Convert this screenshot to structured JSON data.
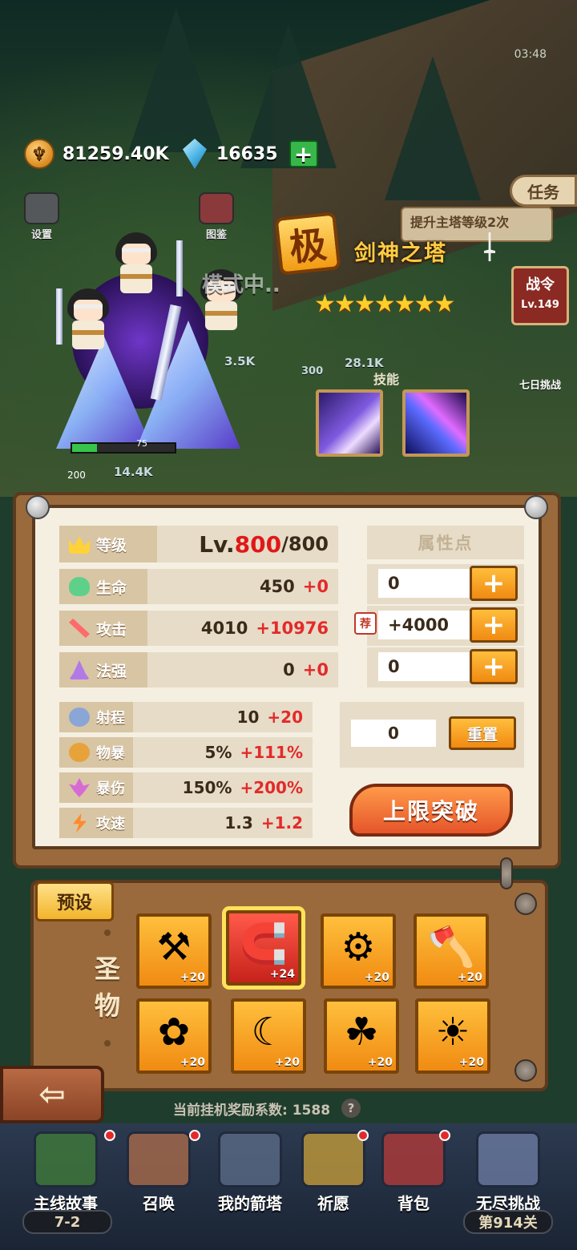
{
  "top": {
    "gold_amount": "81259.40K",
    "diamond_amount": "16635",
    "timer": "03:48"
  },
  "side_buttons": {
    "settings": "设置",
    "guide": "图鉴"
  },
  "tasks": {
    "tab_label": "任务",
    "quest_text": "提升主塔等级2次"
  },
  "battle_pass": {
    "label": "战令",
    "level": "Lv.149"
  },
  "seven_day": {
    "label": "七日挑战"
  },
  "battle": {
    "mode_text": "模式中..",
    "hp_bar_number": "75",
    "hp_fraction": 0.24,
    "level_badge": "200",
    "damage_texts": [
      "28.1K",
      "14.4K",
      "3.5K",
      "300"
    ]
  },
  "tower": {
    "tier_char": "极",
    "name": "剑神之塔",
    "stars": 7,
    "skills_label": "技能"
  },
  "stats": {
    "level": {
      "label": "等级",
      "prefix": "Lv.",
      "current": "800",
      "max": "/800"
    },
    "hp": {
      "label": "生命",
      "value": "450",
      "bonus": "+0"
    },
    "attack": {
      "label": "攻击",
      "value": "4010",
      "bonus": "+10976"
    },
    "magic": {
      "label": "法强",
      "value": "0",
      "bonus": "+0"
    },
    "range": {
      "label": "射程",
      "value": "10",
      "bonus": "+20"
    },
    "crit_rate": {
      "label": "物暴",
      "value": "5%",
      "bonus": "+111%"
    },
    "crit_dmg": {
      "label": "暴伤",
      "value": "150%",
      "bonus": "+200%"
    },
    "atk_speed": {
      "label": "攻速",
      "value": "1.3",
      "bonus": "+1.2"
    }
  },
  "attributes": {
    "header": "属性点",
    "rows": [
      {
        "value": "0",
        "recommended": false
      },
      {
        "value": "+4000",
        "recommended": true,
        "rec_label": "荐"
      },
      {
        "value": "0",
        "recommended": false
      }
    ],
    "plus_label": "+",
    "remaining": "0",
    "reset_label": "重置",
    "break_label": "上限突破"
  },
  "relics": {
    "preset_label": "预设",
    "title": "圣物",
    "items": [
      {
        "icon": "scythe-icon",
        "glyph": "⚒",
        "level": "+20",
        "selected": false
      },
      {
        "icon": "magnet-icon",
        "glyph": "🧲",
        "level": "+24",
        "selected": true
      },
      {
        "icon": "gear-medal-icon",
        "glyph": "⚙",
        "level": "+20",
        "selected": false
      },
      {
        "icon": "battle-axe-icon",
        "glyph": "🪓",
        "level": "+20",
        "selected": false
      },
      {
        "icon": "flower-wreath-icon",
        "glyph": "✿",
        "level": "+20",
        "selected": false
      },
      {
        "icon": "crescent-moon-icon",
        "glyph": "☾",
        "level": "+20",
        "selected": false
      },
      {
        "icon": "clover-card-icon",
        "glyph": "☘",
        "level": "+20",
        "selected": false
      },
      {
        "icon": "sun-icon",
        "glyph": "☀",
        "level": "+20",
        "selected": false
      }
    ]
  },
  "idle": {
    "text": "当前挂机奖励系数: 1588",
    "help": "?"
  },
  "nav": {
    "items": [
      {
        "label": "主线故事",
        "sub": "7-2"
      },
      {
        "label": "召唤"
      },
      {
        "label": "我的箭塔"
      },
      {
        "label": "祈愿"
      },
      {
        "label": "背包"
      },
      {
        "label": "无尽挑战",
        "sub": "第914关"
      }
    ]
  },
  "colors": {
    "accent_orange": "#f08a12",
    "bonus_red": "#e32a2a",
    "title_gold": "#ffcc44"
  }
}
